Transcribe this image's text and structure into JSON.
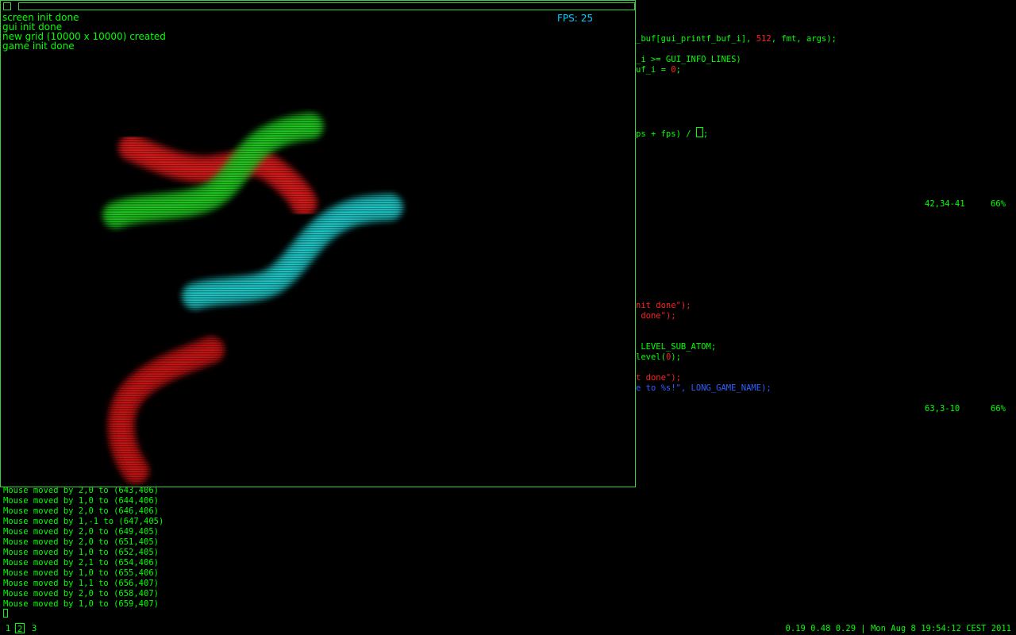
{
  "editor": {
    "lines": [
      {
        "parts": [
          {
            "t": "_buf[gui_printf_buf_i], ",
            "c": "grn"
          },
          {
            "t": "512",
            "c": "red"
          },
          {
            "t": ", fmt, args);",
            "c": "grn"
          }
        ]
      },
      {
        "parts": [
          {
            "t": "_i >= GUI_INFO_LINES)",
            "c": "grn"
          }
        ]
      },
      {
        "parts": [
          {
            "t": "uf_i = ",
            "c": "grn"
          },
          {
            "t": "0",
            "c": "red"
          },
          {
            "t": ";",
            "c": "grn"
          }
        ]
      },
      {
        "parts": [
          {
            "t": "ps + fps) / ",
            "c": "grn"
          }
        ],
        "cursor": true
      },
      {
        "parts": [
          {
            "t": "nit done\");",
            "c": "red"
          }
        ]
      },
      {
        "parts": [
          {
            "t": " done\");",
            "c": "red"
          }
        ]
      },
      {
        "parts": [
          {
            "t": " LEVEL_SUB_ATOM;",
            "c": "grn"
          }
        ]
      },
      {
        "parts": [
          {
            "t": "level(",
            "c": "grn"
          },
          {
            "t": "0",
            "c": "red"
          },
          {
            "t": ");",
            "c": "grn"
          }
        ]
      },
      {
        "parts": [
          {
            "t": "t done\");",
            "c": "red"
          }
        ]
      },
      {
        "parts": [
          {
            "t": "e to %s!\", LONG_GAME_NAME);",
            "c": "blu"
          }
        ]
      }
    ],
    "status_top": {
      "pos": "42,34-41",
      "pct": "66%"
    },
    "status_bottom": {
      "pos": "63,3-10",
      "pct": "66%"
    }
  },
  "game": {
    "log": [
      "screen init done",
      "gui init done",
      "new grid (10000 x 10000) created",
      "game init done"
    ],
    "fps_label": "FPS:",
    "fps_value": "25",
    "worms": [
      {
        "color": "#dd1a1a"
      },
      {
        "color": "#22cc22"
      },
      {
        "color": "#22cccc"
      },
      {
        "color": "#cc1818"
      }
    ]
  },
  "terminal": {
    "lines": [
      "Mouse moved by 2,0 to (643,406)",
      "Mouse moved by 1,0 to (644,406)",
      "Mouse moved by 2,0 to (646,406)",
      "Mouse moved by 1,-1 to (647,405)",
      "Mouse moved by 2,0 to (649,405)",
      "Mouse moved by 2,0 to (651,405)",
      "Mouse moved by 1,0 to (652,405)",
      "Mouse moved by 2,1 to (654,406)",
      "Mouse moved by 1,0 to (655,406)",
      "Mouse moved by 1,1 to (656,407)",
      "Mouse moved by 2,0 to (658,407)",
      "Mouse moved by 1,0 to (659,407)"
    ]
  },
  "bar": {
    "workspaces": [
      "1",
      "2",
      "3"
    ],
    "active_workspace": "2",
    "status": "0.19 0.48 0.29 | Mon Aug 8 19:54:12 CEST 2011"
  }
}
